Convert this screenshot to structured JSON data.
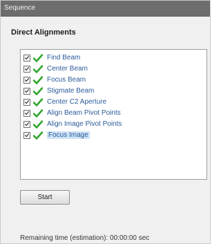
{
  "panel": {
    "title": "Sequence",
    "heading": "Direct Alignments"
  },
  "alignments": [
    {
      "label": "Find Beam",
      "checked": true,
      "status": "done"
    },
    {
      "label": "Center Beam",
      "checked": true,
      "status": "done"
    },
    {
      "label": "Focus Beam",
      "checked": true,
      "status": "done"
    },
    {
      "label": "Stigmate Beam",
      "checked": true,
      "status": "done"
    },
    {
      "label": "Center C2 Aperture",
      "checked": true,
      "status": "done"
    },
    {
      "label": "Align Beam Pivot Points",
      "checked": true,
      "status": "done"
    },
    {
      "label": "Align Image Pivot Points",
      "checked": true,
      "status": "done"
    },
    {
      "label": "Focus Image",
      "checked": true,
      "status": "done",
      "selected": true
    }
  ],
  "controls": {
    "start_label": "Start"
  },
  "status": {
    "remaining_time": "Remaining time (estimation): 00:00:00 sec"
  },
  "colors": {
    "titlebar": "#6d6d6d",
    "check_green": "#2fa52b",
    "selection": "#cfe3f6"
  }
}
